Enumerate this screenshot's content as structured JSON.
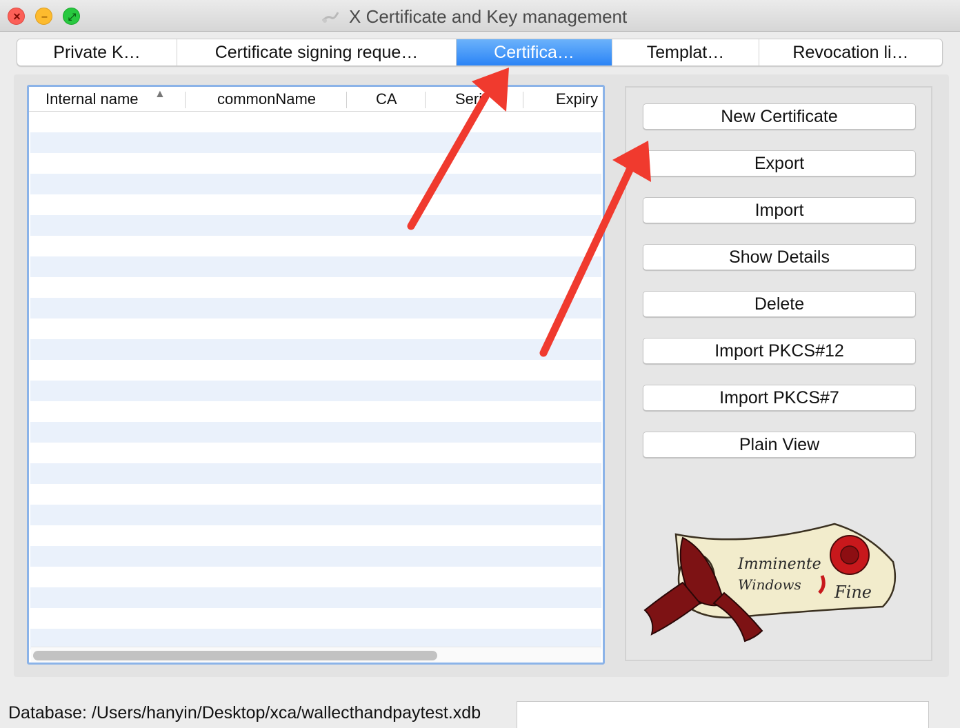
{
  "window": {
    "title": "X Certificate and Key management"
  },
  "tabs": [
    {
      "label": "Private K…",
      "active": false
    },
    {
      "label": "Certificate signing reque…",
      "active": false
    },
    {
      "label": "Certifica…",
      "active": true
    },
    {
      "label": "Templat…",
      "active": false
    },
    {
      "label": "Revocation li…",
      "active": false
    }
  ],
  "table": {
    "columns": [
      "Internal name",
      "commonName",
      "CA",
      "Seri",
      "Expiry"
    ],
    "sorted_column": "Internal name",
    "sort_direction": "ascending",
    "rows": []
  },
  "buttons": [
    {
      "label": "New Certificate"
    },
    {
      "label": "Export"
    },
    {
      "label": "Import"
    },
    {
      "label": "Show Details"
    },
    {
      "label": "Delete"
    },
    {
      "label": "Import PKCS#12"
    },
    {
      "label": "Import PKCS#7"
    },
    {
      "label": "Plain View"
    }
  ],
  "scroll_image": {
    "text": [
      "Imminente",
      "Windows",
      "Fine"
    ]
  },
  "status": {
    "database": "Database: /Users/hanyin/Desktop/xca/wallecthandpaytest.xdb"
  },
  "colors": {
    "active_tab": "#2b84f6",
    "annotation_arrow": "#f03a2e",
    "table_alt_row": "#eaf1fb",
    "table_border": "#8bb3e8"
  }
}
